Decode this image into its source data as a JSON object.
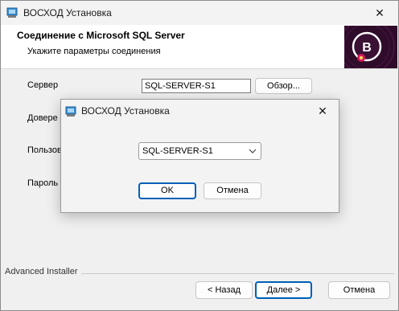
{
  "window": {
    "title": "ВОСХОД Установка",
    "close_glyph": "✕"
  },
  "header": {
    "title": "Соединение с Microsoft SQL Server",
    "subtitle": "Укажите параметры соединения",
    "logo_letter": "B"
  },
  "form": {
    "server_label": "Сервер",
    "server_value": "SQL-SERVER-S1",
    "browse_label": "Обзор...",
    "trusted_label": "Довере",
    "user_label": "Пользов",
    "password_label": "Пароль"
  },
  "footer": {
    "brand": "Advanced Installer",
    "back_label": "< Назад",
    "next_label": "Далее >",
    "cancel_label": "Отмена"
  },
  "modal": {
    "title": "ВОСХОД Установка",
    "close_glyph": "✕",
    "selected_server": "SQL-SERVER-S1",
    "ok_label": "OK",
    "cancel_label": "Отмена"
  },
  "colors": {
    "accent": "#005fb8",
    "logo_bg": "#2e0c2a",
    "logo_ring": "#d4145a"
  }
}
